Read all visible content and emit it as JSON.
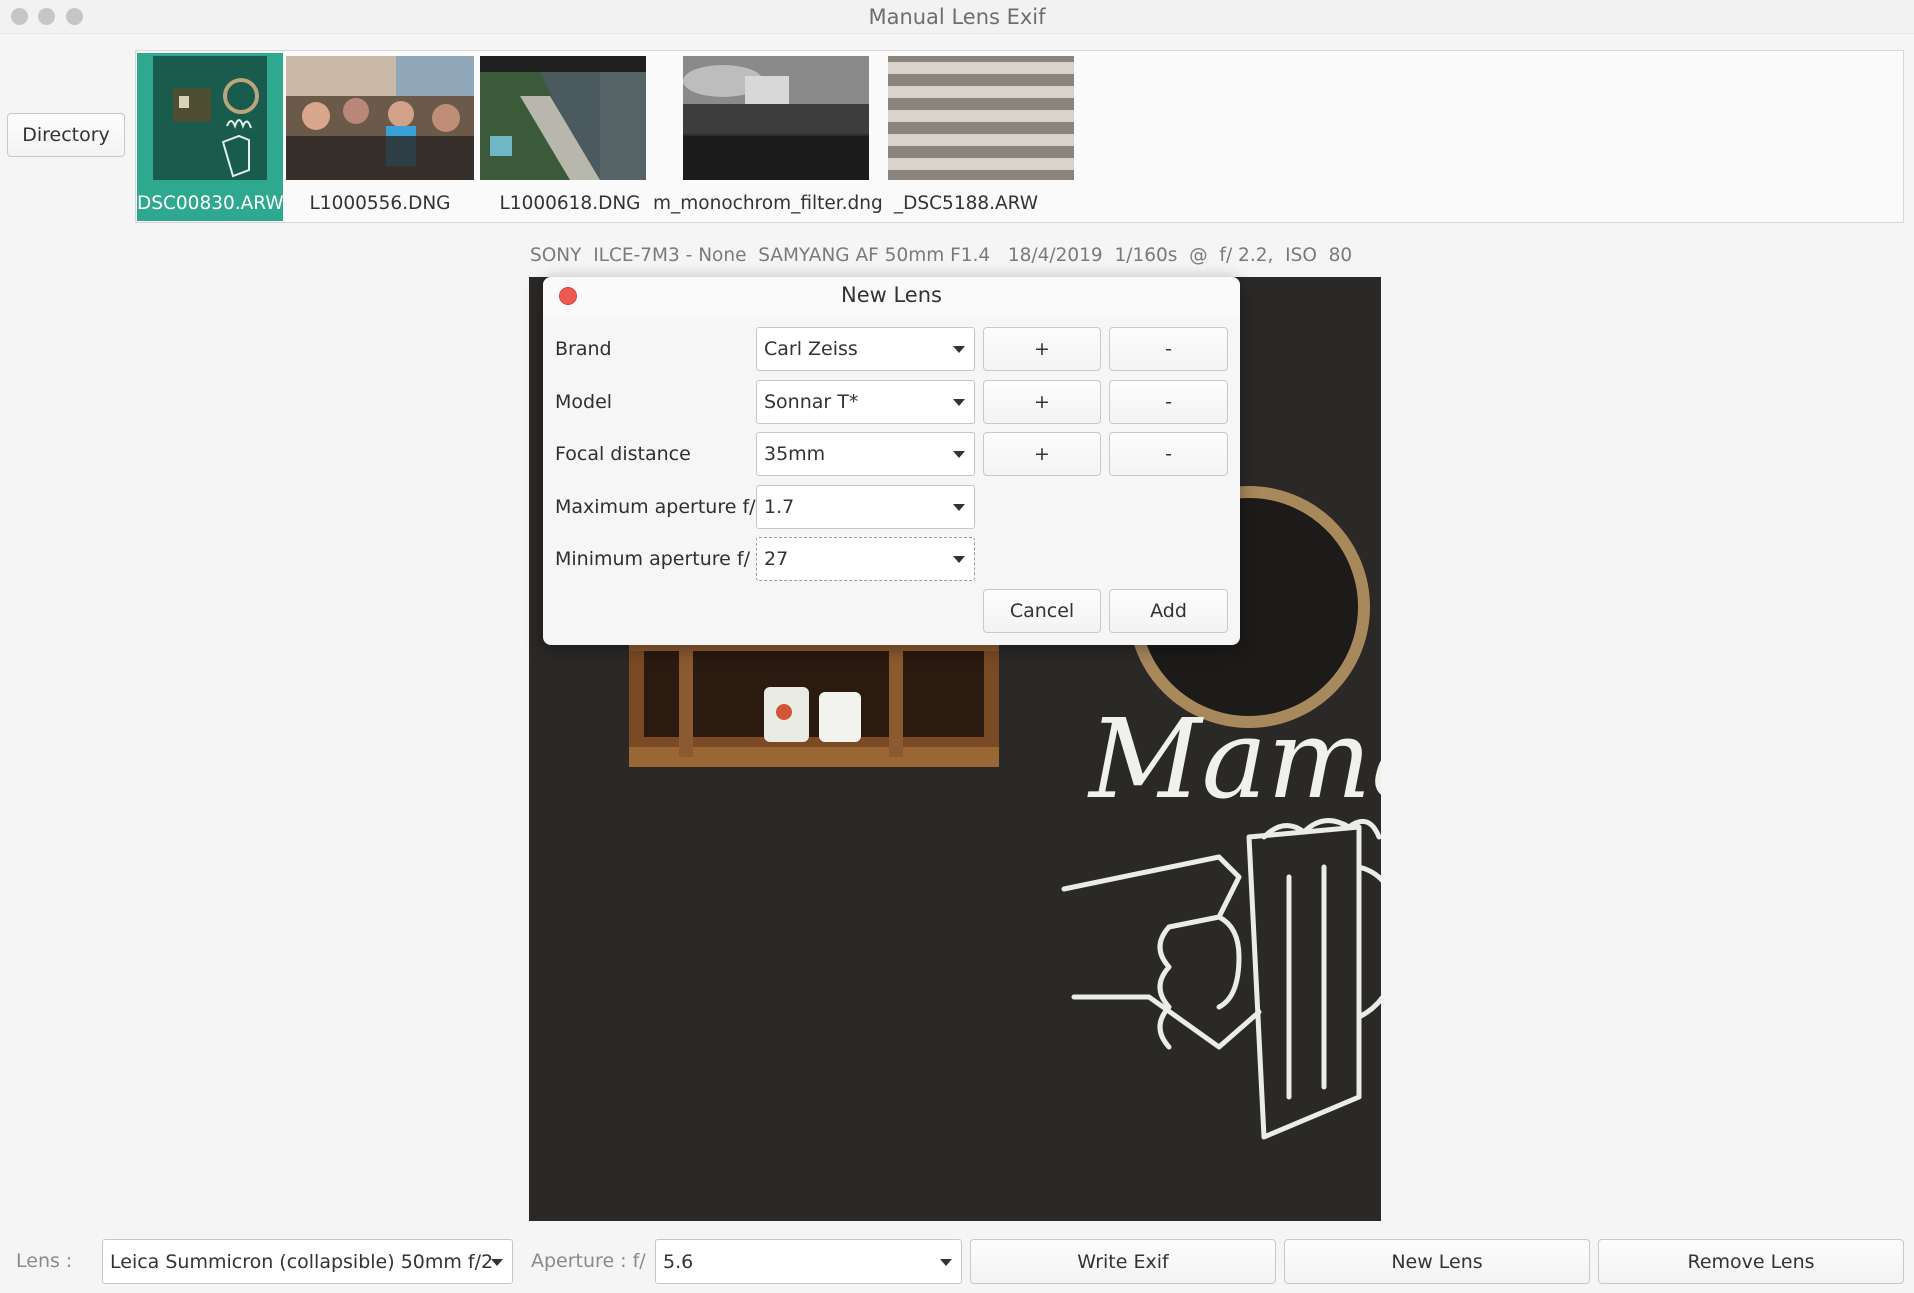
{
  "window": {
    "title": "Manual Lens Exif"
  },
  "toolbar": {
    "directory_label": "Directory"
  },
  "thumbnails": [
    {
      "label": "DSC00830.ARW",
      "selected": true
    },
    {
      "label": "L1000556.DNG",
      "selected": false
    },
    {
      "label": "L1000618.DNG",
      "selected": false
    },
    {
      "label": "m_monochrom_filter.dng",
      "selected": false
    },
    {
      "label": "_DSC5188.ARW",
      "selected": false
    }
  ],
  "exif_info": "SONY  ILCE-7M3 - None  SAMYANG AF 50mm F1.4   18/4/2019  1/160s  @  f/ 2.2,  ISO  80",
  "photo": {
    "chalk_text": "Mama"
  },
  "dialog": {
    "title": "New Lens",
    "rows": [
      {
        "label": "Brand",
        "value": "Carl Zeiss",
        "add": "+",
        "remove": "-"
      },
      {
        "label": "Model",
        "value": "Sonnar T*",
        "add": "+",
        "remove": "-"
      },
      {
        "label": "Focal distance",
        "value": "35mm",
        "add": "+",
        "remove": "-"
      },
      {
        "label": "Maximum aperture f/",
        "value": "1.7"
      },
      {
        "label": "Minimum aperture f/",
        "value": "27"
      }
    ],
    "cancel_label": "Cancel",
    "add_label": "Add"
  },
  "bottom": {
    "lens_label": "Lens :",
    "lens_value": "Leica Summicron (collapsible) 50mm f/2",
    "aperture_label": "Aperture : f/",
    "aperture_value": "5.6",
    "write_exif_label": "Write Exif",
    "new_lens_label": "New Lens",
    "remove_lens_label": "Remove Lens"
  },
  "colors": {
    "selection": "#2ea88f",
    "close_button": "#ee5a52"
  },
  "icons": [
    "close-icon",
    "chevron-down-icon"
  ]
}
